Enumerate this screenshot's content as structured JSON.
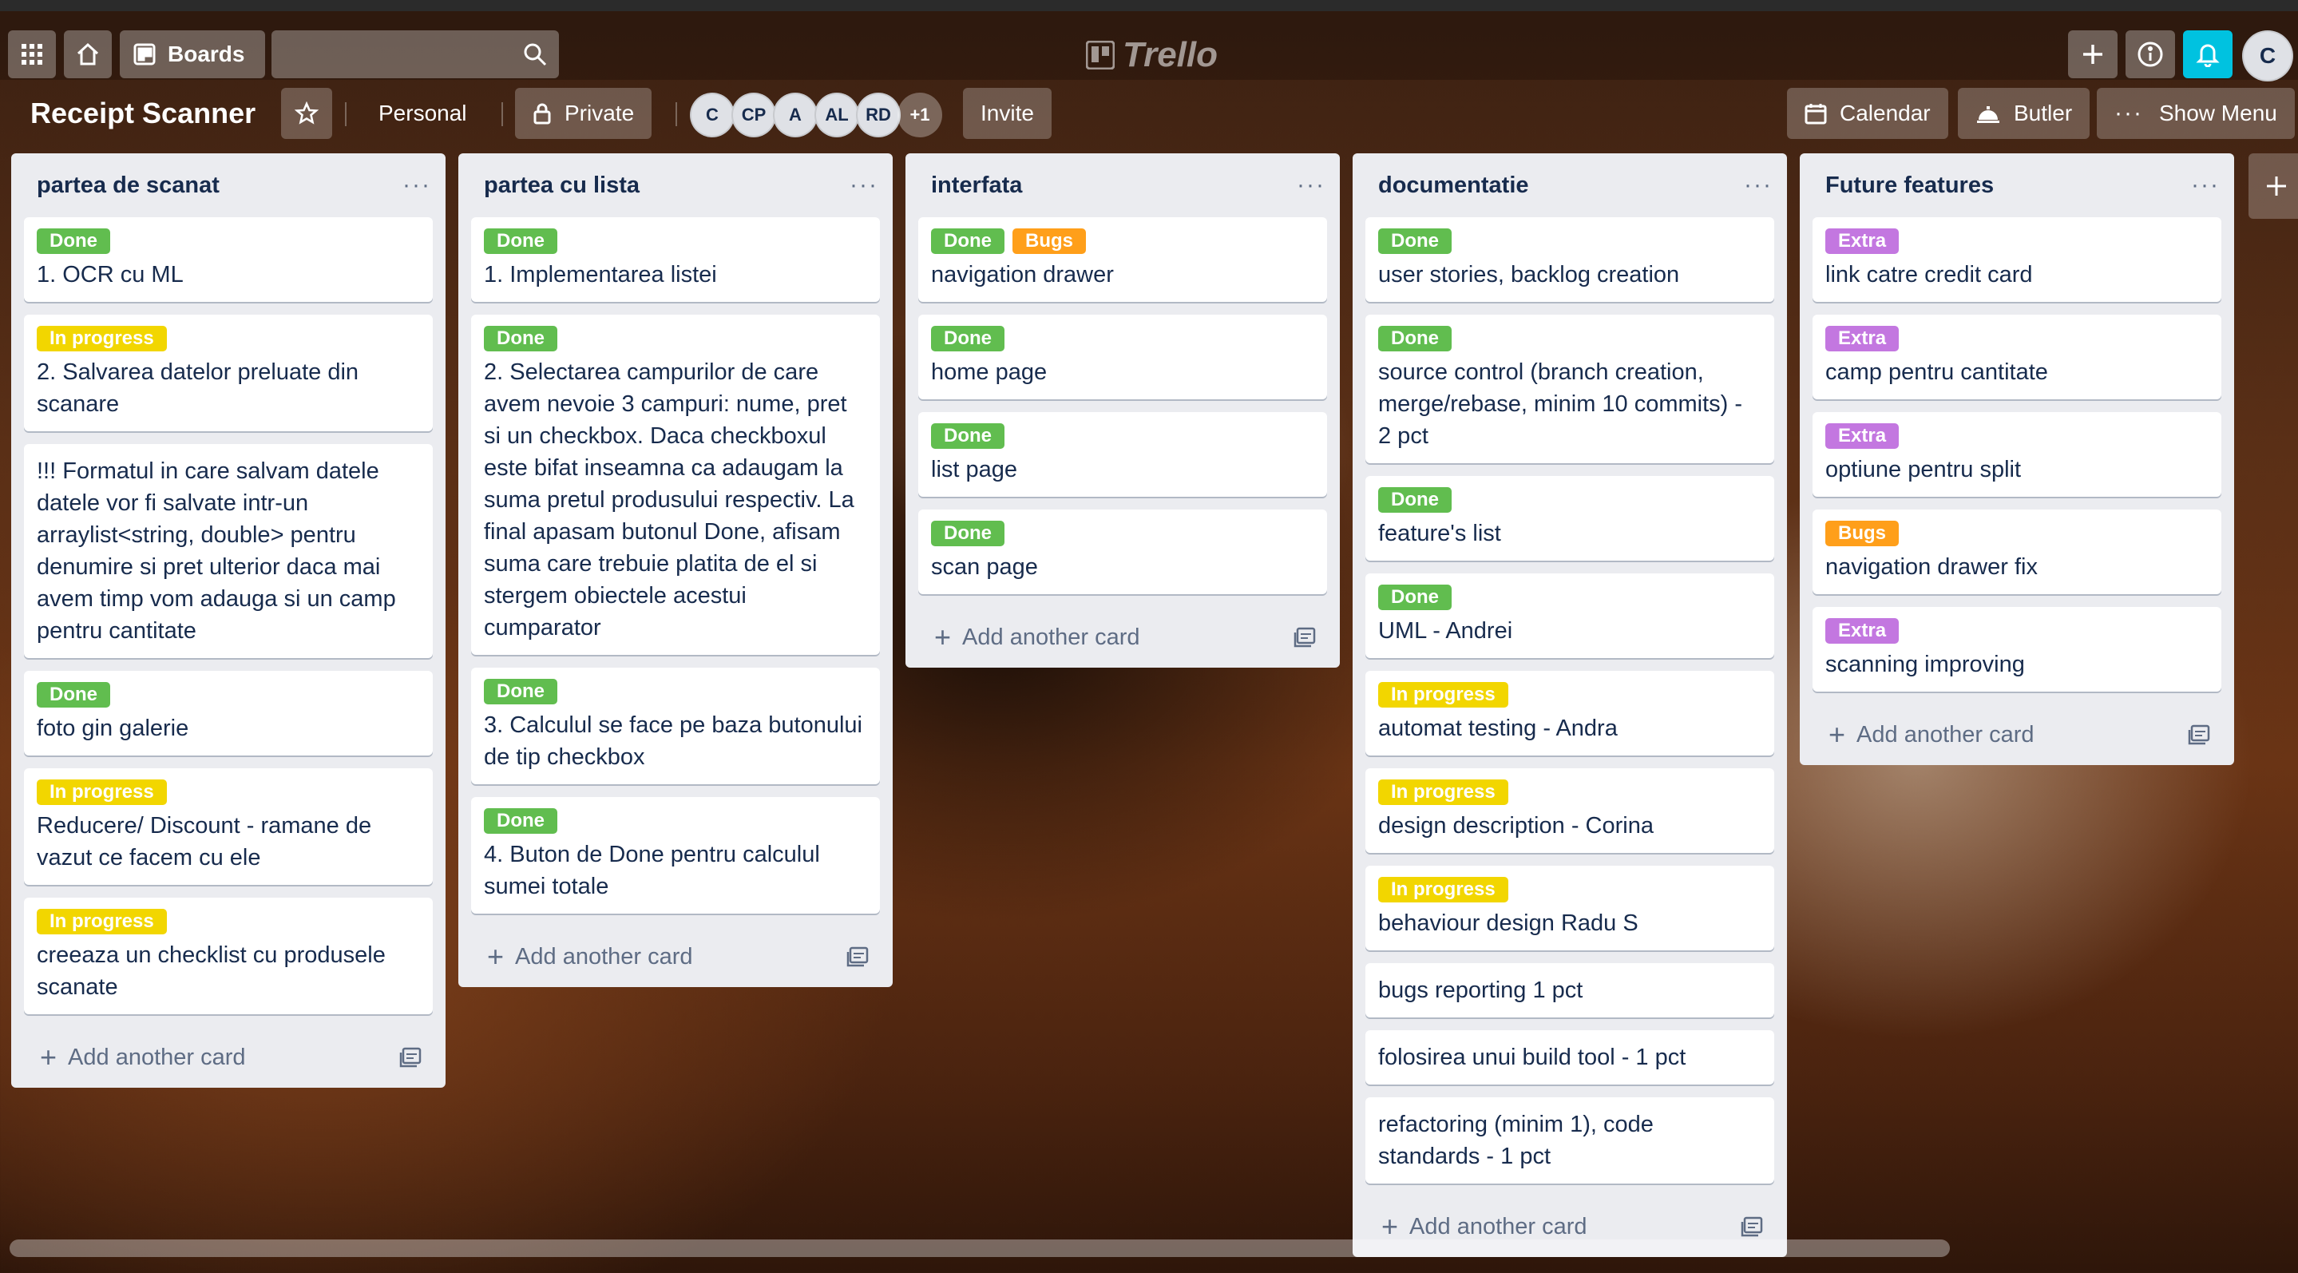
{
  "header": {
    "boards_label": "Boards",
    "logo_text": "Trello",
    "user_initial": "C"
  },
  "board": {
    "title": "Receipt Scanner",
    "team_label": "Personal",
    "visibility_label": "Private",
    "members": [
      "C",
      "CP",
      "A",
      "AL",
      "RD"
    ],
    "members_more": "+1",
    "invite_label": "Invite",
    "calendar_label": "Calendar",
    "butler_label": "Butler",
    "show_menu_label": "Show Menu"
  },
  "label_colors": {
    "Done": "#61bd4f",
    "In progress": "#f2d600",
    "Bugs": "#ff9f1a",
    "Extra": "#c377e0"
  },
  "add_card_label": "Add another card",
  "lists": [
    {
      "title": "partea de scanat",
      "cards": [
        {
          "labels": [
            "Done"
          ],
          "text": "1. OCR cu ML"
        },
        {
          "labels": [
            "In progress"
          ],
          "text": "2. Salvarea datelor preluate din scanare"
        },
        {
          "labels": [],
          "text": "!!! Formatul in care salvam datele datele vor fi salvate intr-un arraylist<string, double> pentru denumire si pret ulterior daca mai avem timp vom adauga si un camp pentru cantitate"
        },
        {
          "labels": [
            "Done"
          ],
          "text": "foto gin galerie"
        },
        {
          "labels": [
            "In progress"
          ],
          "text": "Reducere/ Discount - ramane de vazut ce facem cu ele"
        },
        {
          "labels": [
            "In progress"
          ],
          "text": "creeaza un checklist cu produsele scanate"
        }
      ]
    },
    {
      "title": "partea cu lista",
      "cards": [
        {
          "labels": [
            "Done"
          ],
          "text": "1. Implementarea listei"
        },
        {
          "labels": [
            "Done"
          ],
          "text": "2. Selectarea campurilor de care avem nevoie 3 campuri: nume, pret si un checkbox. Daca checkboxul este bifat inseamna ca adaugam la suma pretul produsului respectiv. La final apasam butonul Done, afisam suma care trebuie platita de el si stergem obiectele acestui cumparator"
        },
        {
          "labels": [
            "Done"
          ],
          "text": "3. Calculul se face pe baza butonului de tip checkbox"
        },
        {
          "labels": [
            "Done"
          ],
          "text": "4. Buton de Done pentru calculul sumei totale"
        }
      ]
    },
    {
      "title": "interfata",
      "cards": [
        {
          "labels": [
            "Done",
            "Bugs"
          ],
          "text": "navigation drawer"
        },
        {
          "labels": [
            "Done"
          ],
          "text": "home page"
        },
        {
          "labels": [
            "Done"
          ],
          "text": "list page"
        },
        {
          "labels": [
            "Done"
          ],
          "text": "scan page"
        }
      ]
    },
    {
      "title": "documentatie",
      "cards": [
        {
          "labels": [
            "Done"
          ],
          "text": "user stories, backlog creation"
        },
        {
          "labels": [
            "Done"
          ],
          "text": "source control (branch creation, merge/rebase, minim 10 commits) - 2 pct"
        },
        {
          "labels": [
            "Done"
          ],
          "text": "feature's list"
        },
        {
          "labels": [
            "Done"
          ],
          "text": "UML - Andrei"
        },
        {
          "labels": [
            "In progress"
          ],
          "text": "automat testing - Andra"
        },
        {
          "labels": [
            "In progress"
          ],
          "text": "design description - Corina"
        },
        {
          "labels": [
            "In progress"
          ],
          "text": "behaviour design Radu S"
        },
        {
          "labels": [],
          "text": "bugs reporting 1 pct"
        },
        {
          "labels": [],
          "text": "folosirea unui build tool - 1 pct"
        },
        {
          "labels": [],
          "text": "refactoring (minim 1), code standards - 1 pct"
        }
      ]
    },
    {
      "title": "Future features",
      "cards": [
        {
          "labels": [
            "Extra"
          ],
          "text": "link catre credit card"
        },
        {
          "labels": [
            "Extra"
          ],
          "text": "camp pentru cantitate"
        },
        {
          "labels": [
            "Extra"
          ],
          "text": "optiune pentru split"
        },
        {
          "labels": [
            "Bugs"
          ],
          "text": "navigation drawer fix"
        },
        {
          "labels": [
            "Extra"
          ],
          "text": "scanning improving"
        }
      ]
    }
  ]
}
